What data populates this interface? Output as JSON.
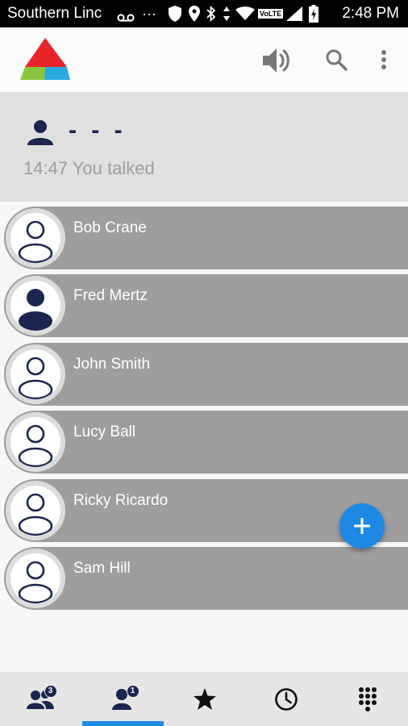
{
  "statusbar": {
    "carrier": "Southern Linc",
    "overflow": "···",
    "network_badge": "VoLTE",
    "time": "2:48 PM"
  },
  "appbar": {
    "icons": [
      "volume-icon",
      "search-icon",
      "more-vert-icon"
    ]
  },
  "call": {
    "caller": "- - -",
    "status": "14:47 You talked"
  },
  "members": [
    {
      "name": "Bob Crane",
      "avatar": "outline"
    },
    {
      "name": "Fred Mertz",
      "avatar": "filled"
    },
    {
      "name": "John Smith",
      "avatar": "outline"
    },
    {
      "name": "Lucy Ball",
      "avatar": "outline"
    },
    {
      "name": "Ricky Ricardo",
      "avatar": "outline"
    },
    {
      "name": "Sam Hill",
      "avatar": "outline"
    }
  ],
  "bottomnav": {
    "tabs": [
      {
        "icon": "groups-icon",
        "badge": "3"
      },
      {
        "icon": "contacts-icon",
        "badge": "1",
        "selected": true
      },
      {
        "icon": "star-icon"
      },
      {
        "icon": "history-icon"
      },
      {
        "icon": "dialpad-icon"
      }
    ]
  },
  "colors": {
    "accent": "#1e88e5",
    "navy": "#1a2550",
    "row_bg": "#9e9e9e",
    "header_bg": "#e0e0e0"
  }
}
